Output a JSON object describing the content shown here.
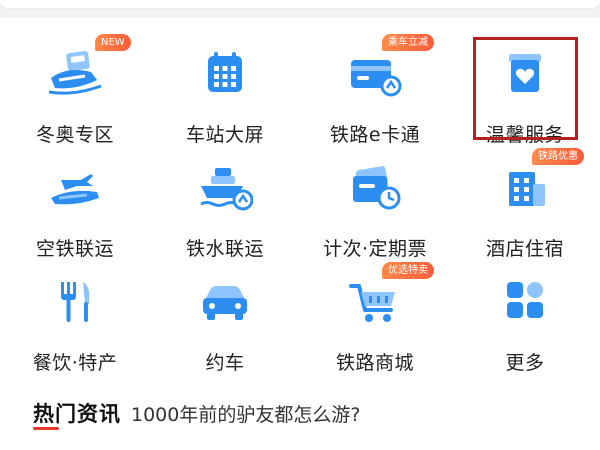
{
  "services": [
    {
      "id": "winter-olympics",
      "label": "冬奥专区",
      "icon": "winter-olympics-train-icon",
      "badge": "NEW",
      "interactable": true
    },
    {
      "id": "station-screen",
      "label": "车站大屏",
      "icon": "calendar-grid-icon",
      "badge": null
    },
    {
      "id": "rail-ecard",
      "label": "铁路e卡通",
      "icon": "rail-card-icon",
      "badge": "乘车立减"
    },
    {
      "id": "warm-service",
      "label": "温馨服务",
      "icon": "heart-box-icon",
      "badge": null
    },
    {
      "id": "air-rail",
      "label": "空铁联运",
      "icon": "airplane-train-icon",
      "badge": null
    },
    {
      "id": "rail-water",
      "label": "铁水联运",
      "icon": "ship-icon",
      "badge": null
    },
    {
      "id": "periodic-ticket",
      "label": "计次·定期票",
      "icon": "ticket-clock-icon",
      "badge": null
    },
    {
      "id": "hotel",
      "label": "酒店住宿",
      "icon": "hotel-building-icon",
      "badge": "铁路优惠"
    },
    {
      "id": "food",
      "label": "餐饮·特产",
      "icon": "fork-knife-icon",
      "badge": null
    },
    {
      "id": "car-hailing",
      "label": "约车",
      "icon": "car-icon",
      "badge": null
    },
    {
      "id": "rail-mall",
      "label": "铁路商城",
      "icon": "shopping-cart-icon",
      "badge": "优选特卖"
    },
    {
      "id": "more",
      "label": "更多",
      "icon": "four-squares-icon",
      "badge": null
    }
  ],
  "news": {
    "section_title": "热门资讯",
    "headline": "1000年前的驴友都怎么游?"
  },
  "colors": {
    "icon_blue": "#2b8ef0",
    "badge_orange": "#ff6a3a",
    "highlight_red": "#b52121",
    "accent_red": "#e8382e"
  }
}
